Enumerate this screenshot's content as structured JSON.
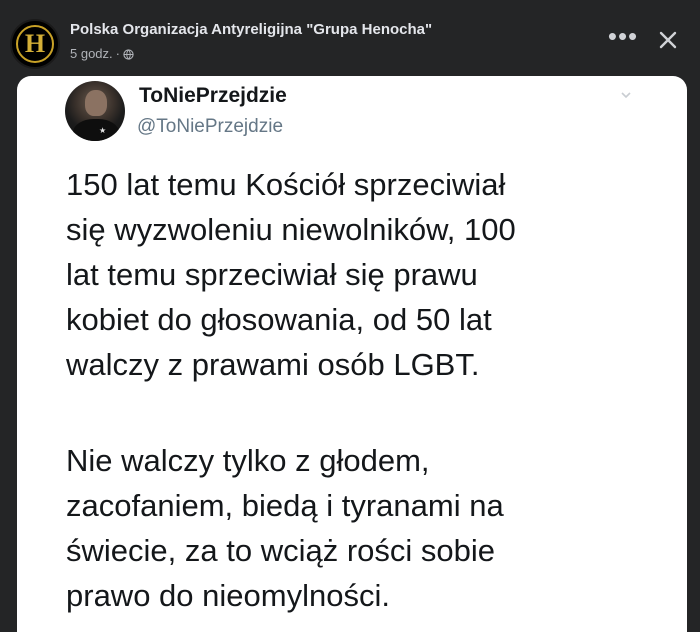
{
  "post": {
    "page_name": "Polska Organizacja Antyreligijna \"Grupa Henocha\"",
    "avatar_letter": "H",
    "time": "5 godz.",
    "separator": "·",
    "more_label": "•••",
    "icons": {
      "visibility": "globe-icon",
      "more": "more-icon",
      "close": "close-icon"
    }
  },
  "tweet": {
    "display_name": "ToNiePrzejdzie",
    "handle": "@ToNiePrzejdzie",
    "paragraph1": "150 lat temu Kościół sprzeciwiał\nsię wyzwoleniu niewolników, 100\nlat temu sprzeciwiał się prawu\nkobiet do głosowania, od 50 lat\nwalczy z prawami osób LGBT.",
    "paragraph2": "Nie walczy tylko z głodem,\nzacofaniem, biedą i tyranami na\nświecie, za to wciąż rości sobie\nprawo do nieomylności.",
    "icons": {
      "menu": "chevron-down-icon",
      "avatar_badge": "star-icon"
    }
  },
  "colors": {
    "app_background": "#242526",
    "card_background": "#ffffff",
    "primary_text": "#e4e6eb",
    "secondary_text": "#b0b3b8",
    "tweet_text": "#14171a",
    "handle_text": "#657786",
    "avatar_gold": "#d4af37"
  }
}
